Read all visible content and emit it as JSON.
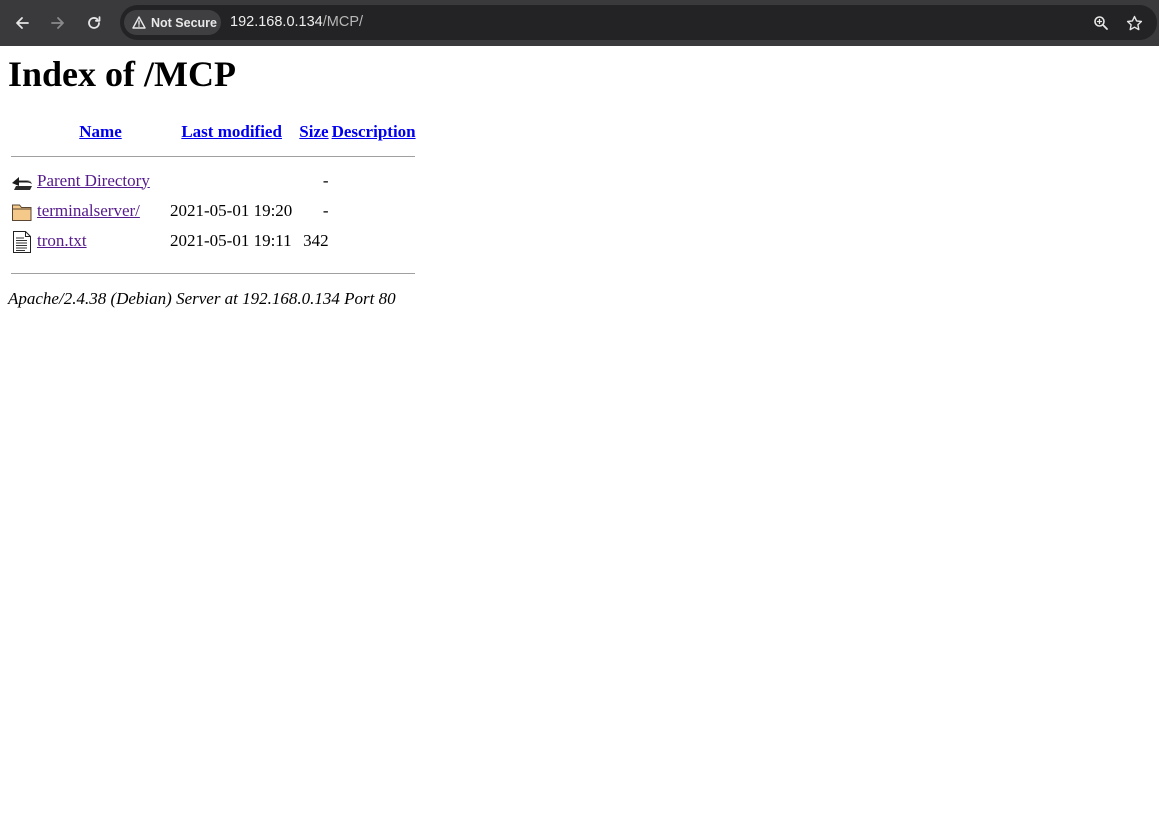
{
  "browser": {
    "security_label": "Not Secure",
    "url_host": "192.168.0.134",
    "url_path": "/MCP/"
  },
  "page": {
    "title": "Index of /MCP",
    "columns": {
      "name": "Name",
      "last_modified": "Last modified",
      "size": "Size",
      "description": "Description"
    },
    "rows": [
      {
        "icon": "back-arrow-icon",
        "name": "Parent Directory",
        "modified": "",
        "size": "-",
        "description": ""
      },
      {
        "icon": "folder-icon",
        "name": "terminalserver/",
        "modified": "2021-05-01 19:20",
        "size": "-",
        "description": ""
      },
      {
        "icon": "text-file-icon",
        "name": "tron.txt",
        "modified": "2021-05-01 19:11",
        "size": "342",
        "description": ""
      }
    ],
    "footer": "Apache/2.4.38 (Debian) Server at 192.168.0.134 Port 80"
  },
  "colors": {
    "link": "#0000ee",
    "visited_link": "#551a8b",
    "toolbar_bg": "#3a3a3d",
    "omnibox_bg": "#232325"
  }
}
